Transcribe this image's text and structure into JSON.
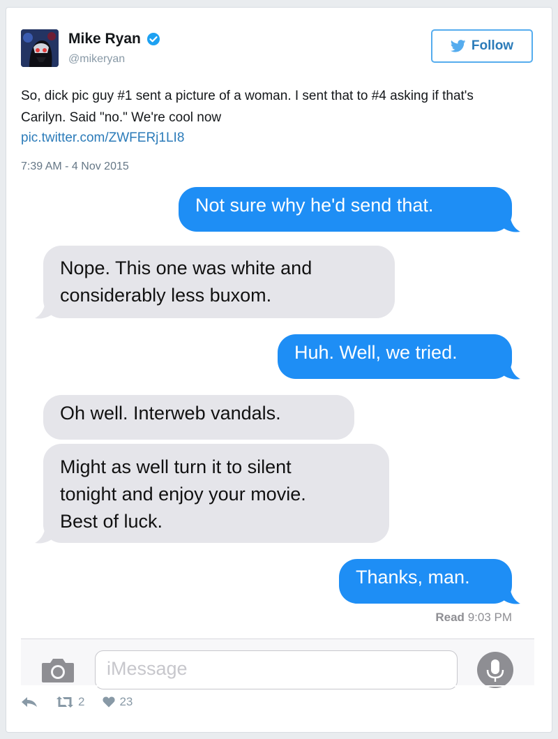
{
  "tweet": {
    "display_name": "Mike Ryan",
    "handle": "@mikeryan",
    "follow_label": "Follow",
    "text": "So, dick pic guy #1 sent a picture of a woman. I sent that to #4 asking if that's Carilyn. Said \"no.\" We're cool now",
    "link": "pic.twitter.com/ZWFERj1LI8",
    "timestamp": "7:39 AM - 4 Nov 2015",
    "retweet_count": "2",
    "like_count": "23",
    "icons": [
      "verified-icon",
      "twitter-bird-icon",
      "reply-icon",
      "retweet-icon",
      "heart-icon"
    ],
    "colors": {
      "link": "#2b7bb9",
      "follow": "#55acee"
    }
  },
  "conversation": {
    "messages": [
      {
        "from": "me",
        "text": "Not sure why he'd send that."
      },
      {
        "from": "them",
        "lines": [
          "Nope. This one was white and",
          "considerably less buxom."
        ]
      },
      {
        "from": "me",
        "text": "Huh. Well, we tried."
      },
      {
        "from": "them",
        "text": "Oh well. Interweb vandals."
      },
      {
        "from": "them",
        "lines": [
          "Might as well turn it to silent",
          "tonight and enjoy your movie.",
          "Best of luck."
        ]
      },
      {
        "from": "me",
        "text": "Thanks, man."
      }
    ],
    "read_label": "Read",
    "read_time": "9:03 PM",
    "input_placeholder": "iMessage",
    "icons": [
      "camera-icon",
      "microphone-icon"
    ],
    "colors": {
      "sent": "#1e8ef5",
      "received": "#e5e5ea"
    }
  }
}
